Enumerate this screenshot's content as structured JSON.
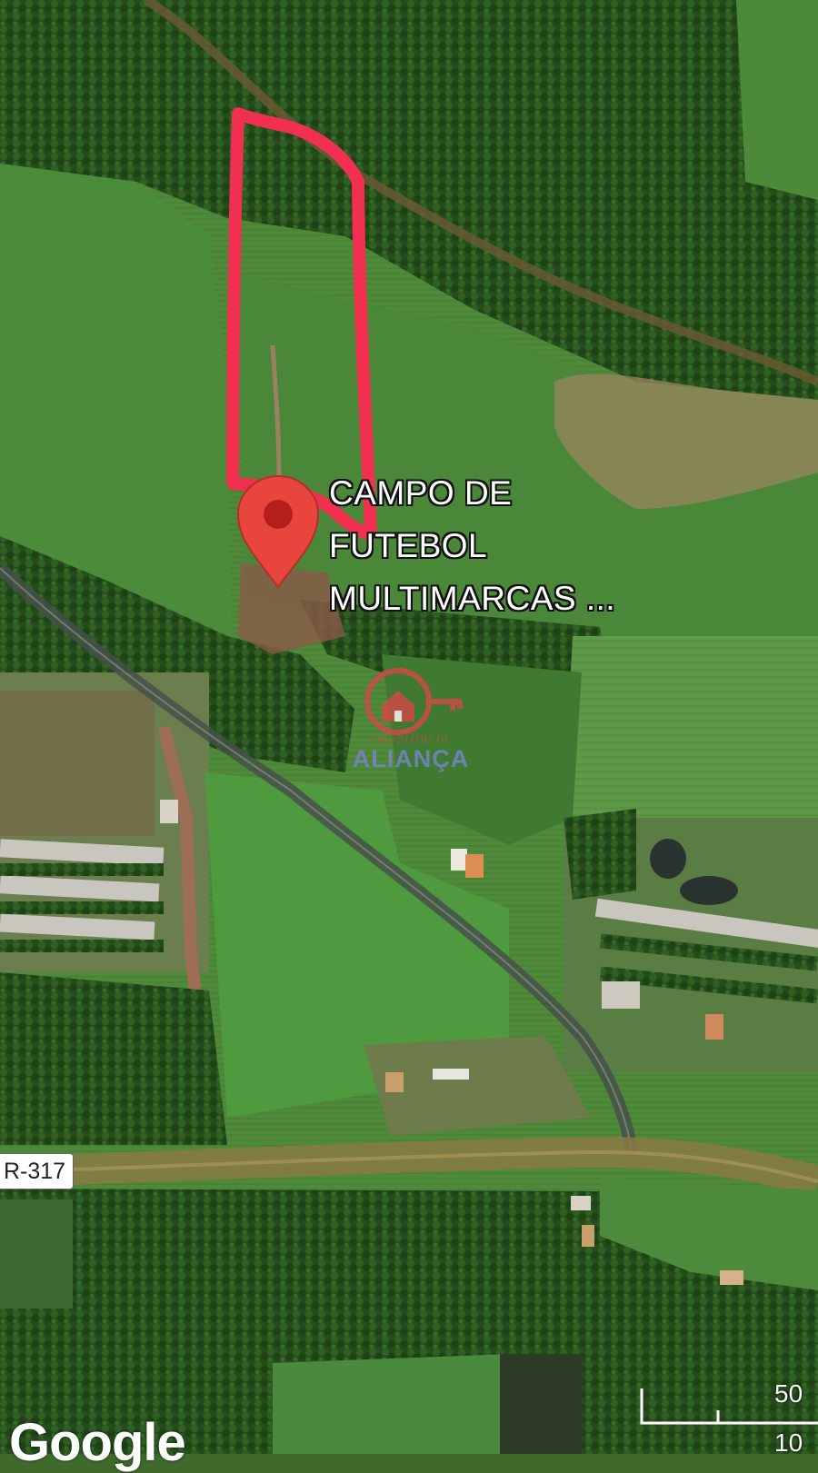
{
  "map": {
    "type": "satellite",
    "poi": {
      "label_lines": [
        "CAMPO DE",
        "FUTEBOL",
        "MULTIMARCAS ..."
      ],
      "marker_color": "#e8453c"
    },
    "road_shield": "R-317",
    "watermark": {
      "subtitle": "imobiliária",
      "name": "ALIANÇA"
    },
    "attribution": "Google",
    "scale_labels": [
      "50",
      "10"
    ],
    "annotation": {
      "shape": "hand-drawn outline",
      "color": "#f0304e"
    }
  }
}
